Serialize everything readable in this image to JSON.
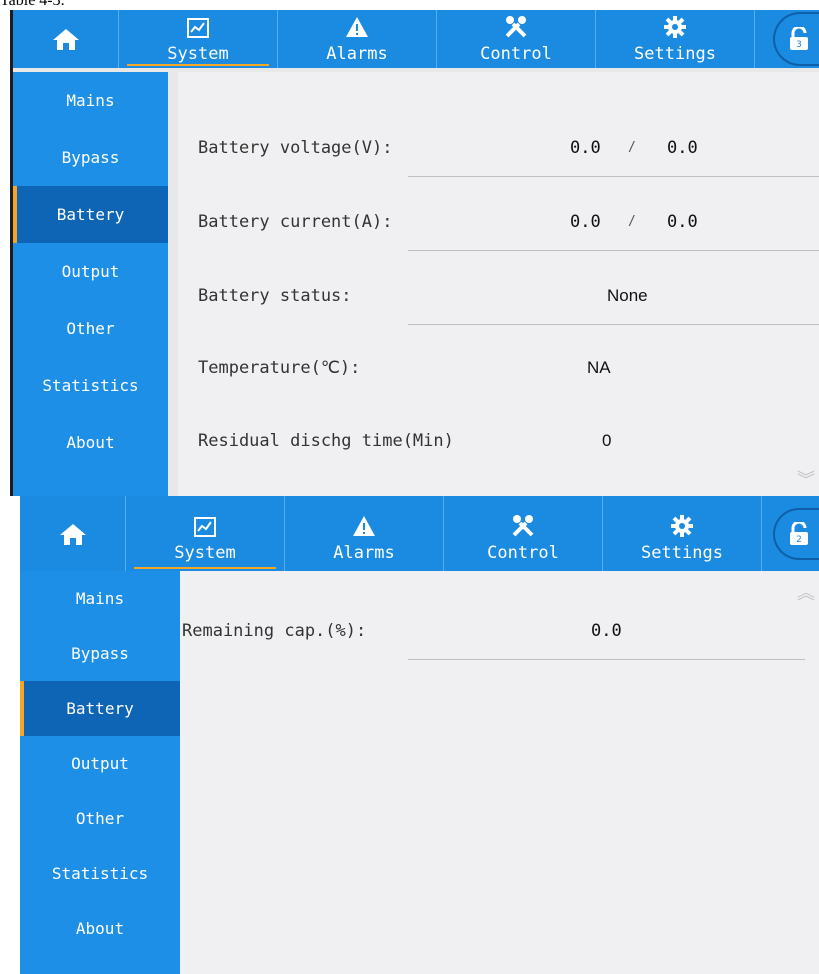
{
  "caption": "Table 4-3.",
  "nav": {
    "tabs": [
      {
        "label": "System",
        "icon": "chart-icon",
        "active": true
      },
      {
        "label": "Alarms",
        "icon": "warning-icon",
        "active": false
      },
      {
        "label": "Control",
        "icon": "tools-icon",
        "active": false
      },
      {
        "label": "Settings",
        "icon": "gear-icon",
        "active": false
      }
    ],
    "home_icon": "home-icon",
    "lock_icon": "unlock-icon",
    "lock_badges": [
      "3",
      "2"
    ]
  },
  "sidebar": {
    "items": [
      "Mains",
      "Bypass",
      "Battery",
      "Output",
      "Other",
      "Statistics",
      "About"
    ],
    "active": "Battery"
  },
  "page1": {
    "rows": [
      {
        "label": "Battery voltage(V):",
        "value": "0.0",
        "sep": "/",
        "value2": "0.0"
      },
      {
        "label": "Battery current(A):",
        "value": "0.0",
        "sep": "/",
        "value2": "0.0"
      },
      {
        "label": "Battery status:",
        "value": "None"
      },
      {
        "label": "Temperature(℃):",
        "value": "NA"
      },
      {
        "label": "Residual dischg time(Min)",
        "value": "0"
      }
    ],
    "scroll_icon": "chevron-double-down-icon"
  },
  "page2": {
    "rows": [
      {
        "label": "Remaining cap.(%):",
        "value": "0.0"
      }
    ],
    "scroll_icon": "chevron-double-up-icon"
  },
  "colors": {
    "topbar": "#1a8be0",
    "sidebar": "#1e8fe6",
    "sidebar_active": "#0e64b5",
    "accent": "#f5a623",
    "content_bg": "#f0f0f2"
  }
}
